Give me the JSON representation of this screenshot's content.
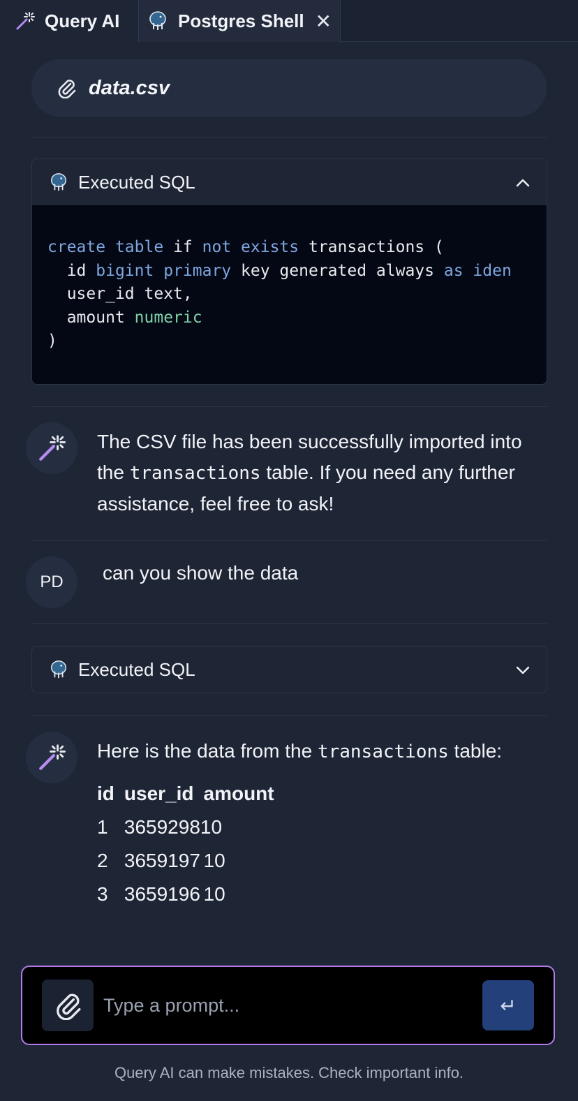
{
  "tabs": [
    {
      "label": "Query AI",
      "icon": "magic-wand-icon"
    },
    {
      "label": "Postgres Shell",
      "icon": "postgres-elephant-icon",
      "close": "✕"
    }
  ],
  "attachment": {
    "filename": "data.csv",
    "icon": "paperclip-icon"
  },
  "sql_cards": [
    {
      "title": "Executed SQL",
      "expanded": true,
      "chevron": "⌃",
      "code_lines": [
        "create table if not exists transactions (",
        "  id bigint primary key generated always as iden",
        "  user_id text,",
        "  amount numeric",
        ")"
      ]
    },
    {
      "title": "Executed SQL",
      "expanded": false,
      "chevron": "⌄"
    }
  ],
  "messages": [
    {
      "role": "assistant",
      "parts": [
        "The CSV file has been successfully imported into the ",
        "transactions",
        " table. If you need any further assistance, feel free to ask!"
      ]
    },
    {
      "role": "user",
      "avatar": "PD",
      "text": "can you show the data"
    },
    {
      "role": "assistant",
      "parts": [
        "Here is the data from the ",
        "transactions",
        " table:"
      ],
      "table": {
        "columns": [
          "id",
          "user_id",
          "amount"
        ],
        "rows": [
          [
            "1",
            "365929810",
            ""
          ],
          [
            "2",
            "3659197",
            "10"
          ],
          [
            "3",
            "3659196",
            "10"
          ]
        ]
      }
    }
  ],
  "prompt": {
    "placeholder": "Type a prompt...",
    "send_label": "↵"
  },
  "disclaimer": "Query AI can make mistakes. Check important info.",
  "colors": {
    "accent_border": "#b27cf0",
    "send_button": "#23407a",
    "keyword": "#7fa6de",
    "type": "#7fd1a8"
  }
}
